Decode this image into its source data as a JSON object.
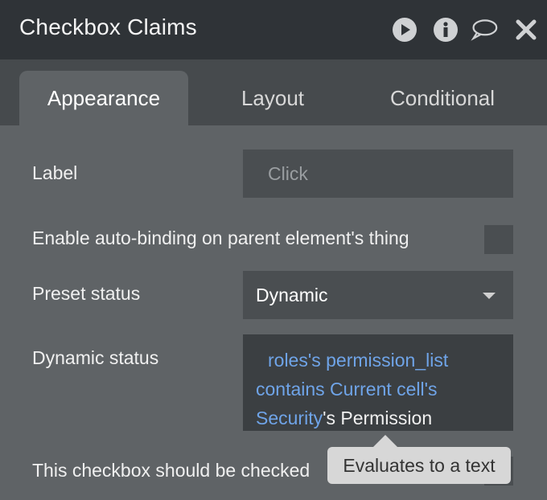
{
  "window": {
    "title": "Checkbox Claims",
    "icons": [
      "play-icon",
      "info-icon",
      "comment-icon",
      "close-icon"
    ]
  },
  "tabs": [
    {
      "label": "Appearance",
      "active": true
    },
    {
      "label": "Layout",
      "active": false
    },
    {
      "label": "Conditional",
      "active": false
    }
  ],
  "form": {
    "label": {
      "label": "Label",
      "placeholder": "Click"
    },
    "auto_binding": {
      "label": "Enable auto-binding on parent element's thing",
      "checked": false
    },
    "preset_status": {
      "label": "Preset status",
      "value": "Dynamic"
    },
    "dynamic_status": {
      "label": "Dynamic status",
      "expr_1": "roles's permission_list",
      "expr_2": "contains Current cell's",
      "expr_3": "Security",
      "expr_4": "'s Permission"
    },
    "checked_row": {
      "label": "This checkbox should be checked",
      "checked": false
    }
  },
  "tooltip": {
    "text": "Evaluates to a text"
  },
  "colors": {
    "accent_blue": "#6fa4e8",
    "header_bg": "#2f3337",
    "panel_bg": "#5f6366"
  }
}
